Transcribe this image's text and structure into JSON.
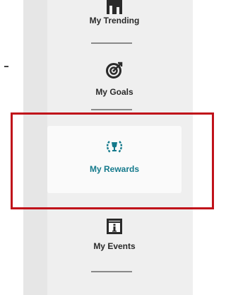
{
  "sidebar": {
    "items": [
      {
        "label": "My Trending",
        "icon": "bar-chart-icon",
        "selected": false
      },
      {
        "label": "My Goals",
        "icon": "target-icon",
        "selected": false
      },
      {
        "label": "My Rewards",
        "icon": "trophy-laurel-icon",
        "selected": true
      },
      {
        "label": "My Events",
        "icon": "info-calendar-icon",
        "selected": false
      }
    ]
  },
  "colors": {
    "selected_label": "#157a8c",
    "highlight_border": "#c0111a",
    "panel_background": "#efefef"
  }
}
